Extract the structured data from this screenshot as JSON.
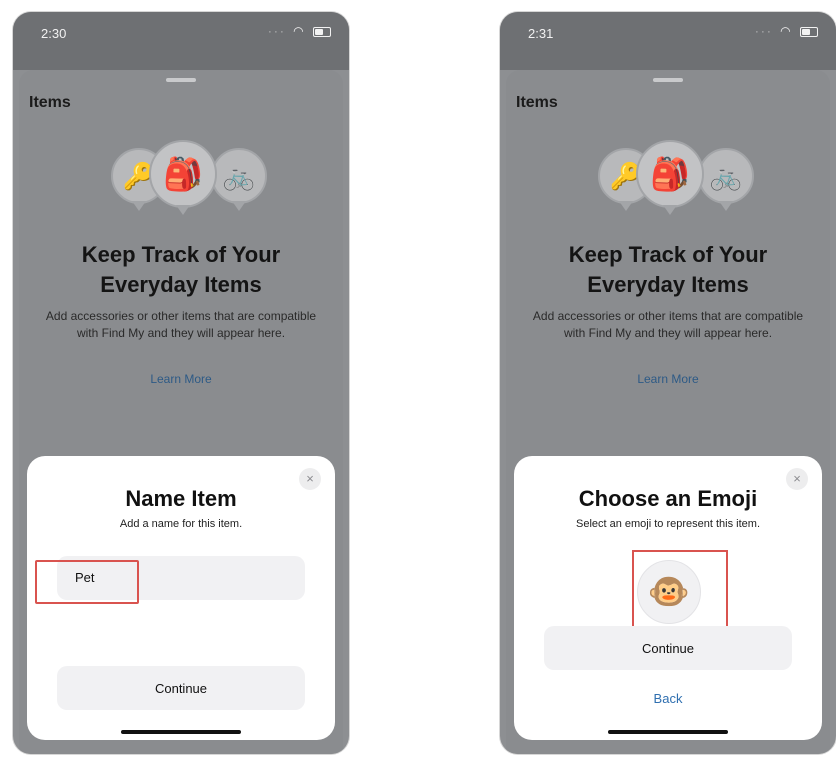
{
  "left_screen": {
    "status_time": "2:30",
    "items_title": "Items",
    "headline_line1": "Keep Track of Your",
    "headline_line2": "Everyday Items",
    "description": "Add accessories or other items that are compatible with Find My and they will appear here.",
    "learn_more": "Learn More",
    "modal": {
      "title": "Name Item",
      "subtitle": "Add a name for this item.",
      "name_value": "Pet",
      "continue_label": "Continue",
      "close_glyph": "×"
    }
  },
  "right_screen": {
    "status_time": "2:31",
    "items_title": "Items",
    "headline_line1": "Keep Track of Your",
    "headline_line2": "Everyday Items",
    "description": "Add accessories or other items that are compatible with Find My and they will appear here.",
    "learn_more": "Learn More",
    "modal": {
      "title": "Choose an Emoji",
      "subtitle": "Select an emoji to represent this item.",
      "selected_emoji": "🐵",
      "continue_label": "Continue",
      "back_label": "Back",
      "close_glyph": "×"
    }
  },
  "icons": {
    "key": "🔑",
    "backpack": "🎒",
    "bicycle": "🚲",
    "wifi": "wifi-icon",
    "battery": "battery-icon"
  },
  "colors": {
    "highlight": "#d9534f",
    "link": "#2f6fb0"
  }
}
